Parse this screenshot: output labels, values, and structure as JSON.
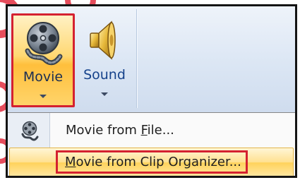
{
  "ribbon": {
    "buttons": [
      {
        "label": "Movie",
        "icon": "film-reel-icon",
        "state": "pressed-highlighted"
      },
      {
        "label": "Sound",
        "icon": "speaker-icon",
        "state": "normal"
      }
    ]
  },
  "menu": {
    "items": [
      {
        "label_pre": "Movie from ",
        "label_key": "F",
        "label_post": "ile...",
        "icon": "film-reel-small-icon"
      },
      {
        "label_pre": "",
        "label_key": "M",
        "label_post": "ovie from Clip Organizer...",
        "icon": "",
        "state": "hovered-highlighted"
      }
    ]
  },
  "colors": {
    "highlight_border": "#d42130",
    "ribbon_text": "#15428b",
    "hover_fill": "#ffd873"
  }
}
